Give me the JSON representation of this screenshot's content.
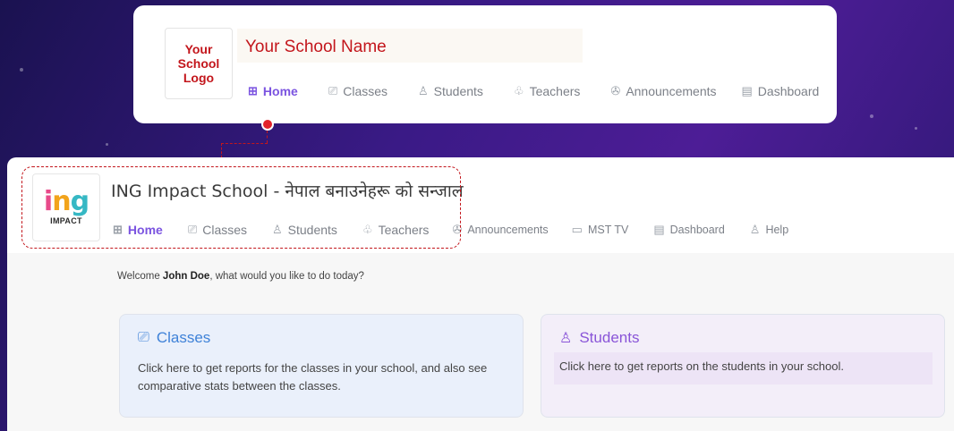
{
  "template_card": {
    "logo_lines": [
      "Your",
      "School",
      "Logo"
    ],
    "school_name": "Your School Name",
    "nav": [
      {
        "label": "Home",
        "icon": "grid-icon",
        "glyph": "⊞",
        "active": true
      },
      {
        "label": "Classes",
        "icon": "classroom-icon",
        "glyph": "⎚",
        "active": false
      },
      {
        "label": "Students",
        "icon": "student-icon",
        "glyph": "♙",
        "active": false
      },
      {
        "label": "Teachers",
        "icon": "teacher-icon",
        "glyph": "♧",
        "active": false
      },
      {
        "label": "Announcements",
        "icon": "megaphone-icon",
        "glyph": "✇",
        "active": false
      },
      {
        "label": "Dashboard",
        "icon": "dashboard-icon",
        "glyph": "▤",
        "active": false
      }
    ]
  },
  "app": {
    "logo": {
      "word_parts": [
        "i",
        "n",
        "g"
      ],
      "subtitle": "IMPACT"
    },
    "school_name": "ING Impact School - नेपाल बनाउनेहरू को सन्जाल",
    "nav": [
      {
        "label": "Home",
        "icon": "grid-icon",
        "glyph": "⊞",
        "active": true
      },
      {
        "label": "Classes",
        "icon": "classroom-icon",
        "glyph": "⎚",
        "active": false
      },
      {
        "label": "Students",
        "icon": "student-icon",
        "glyph": "♙",
        "active": false
      },
      {
        "label": "Teachers",
        "icon": "teacher-icon",
        "glyph": "♧",
        "active": false
      },
      {
        "label": "Announcements",
        "icon": "megaphone-icon",
        "glyph": "✇",
        "active": false
      },
      {
        "label": "MST TV",
        "icon": "tv-icon",
        "glyph": "▭",
        "active": false
      },
      {
        "label": "Dashboard",
        "icon": "dashboard-icon",
        "glyph": "▤",
        "active": false
      },
      {
        "label": "Help",
        "icon": "help-icon",
        "glyph": "♙",
        "active": false
      }
    ],
    "welcome": {
      "prefix": "Welcome ",
      "user": "John Doe",
      "suffix": ", what would you like to do today?"
    },
    "cards": {
      "classes": {
        "title": "Classes",
        "icon_glyph": "⎚",
        "description_line1": "Click here to get reports for the classes in your school, and also see",
        "description_line2": "comparative stats between the classes."
      },
      "students": {
        "title": "Students",
        "icon_glyph": "♙",
        "description": "Click here to get reports on the students in your school."
      }
    }
  },
  "colors": {
    "brand_red": "#c3161c",
    "active_nav": "#7b54e0",
    "classes_blue": "#3f82d8",
    "students_purple": "#8a55d8"
  }
}
